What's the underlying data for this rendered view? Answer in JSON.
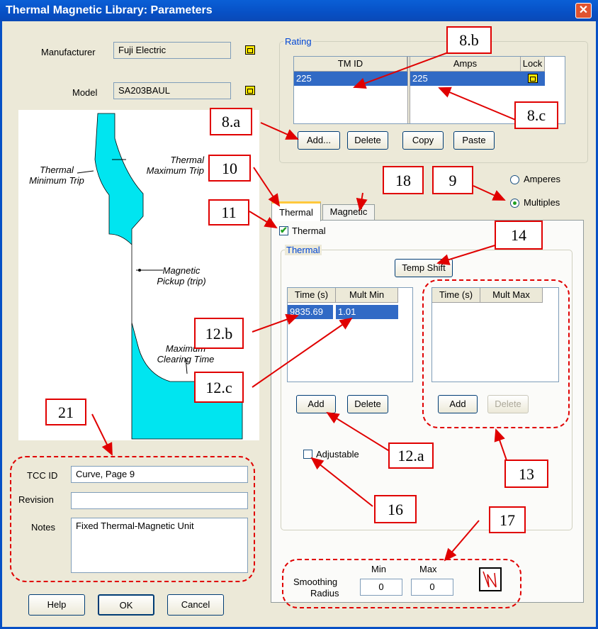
{
  "window": {
    "title": "Thermal Magnetic Library: Parameters",
    "close": "✕"
  },
  "manufacturer": {
    "label": "Manufacturer",
    "value": "Fuji Electric"
  },
  "model": {
    "label": "Model",
    "value": "SA203BAUL"
  },
  "curve_labels": {
    "thermal_min": "Thermal\nMinimum Trip",
    "thermal_max": "Thermal\nMaximum Trip",
    "magnetic": "Magnetic\nPickup (trip)",
    "clearing": "Maximum\nClearing Time"
  },
  "rating": {
    "title": "Rating",
    "columns": [
      "TM ID",
      "Amps",
      "Lock"
    ],
    "rows": [
      {
        "tm_id": "225",
        "amps": "225"
      }
    ],
    "buttons": {
      "add": "Add...",
      "delete": "Delete",
      "copy": "Copy",
      "paste": "Paste"
    }
  },
  "mode": {
    "amperes": "Amperes",
    "multiples": "Multiples",
    "selected": "Multiples"
  },
  "tabs": {
    "thermal": "Thermal",
    "magnetic": "Magnetic",
    "active": "Thermal"
  },
  "thermal_check": {
    "label": "Thermal",
    "checked": true
  },
  "thermal_group": {
    "title": "Thermal",
    "temp_shift": "Temp Shift",
    "min_table": {
      "columns": [
        "Time (s)",
        "Mult Min"
      ],
      "rows": [
        {
          "time": "9835.69",
          "mult": "1.01"
        }
      ]
    },
    "max_table": {
      "columns": [
        "Time (s)",
        "Mult Max"
      ],
      "rows": []
    },
    "add": "Add",
    "delete": "Delete",
    "adjustable": "Adjustable"
  },
  "smoothing": {
    "label_line1": "Smoothing",
    "label_line2": "Radius",
    "min_label": "Min",
    "max_label": "Max",
    "min": "0",
    "max": "0"
  },
  "tcc": {
    "label": "TCC ID",
    "value": "Curve, Page 9"
  },
  "revision": {
    "label": "Revision",
    "value": ""
  },
  "notes": {
    "label": "Notes",
    "value": "Fixed Thermal-Magnetic Unit"
  },
  "footer": {
    "help": "Help",
    "ok": "OK",
    "cancel": "Cancel"
  },
  "callouts": {
    "c8a": "8.a",
    "c8b": "8.b",
    "c8c": "8.c",
    "c9": "9",
    "c10": "10",
    "c11": "11",
    "c12a": "12.a",
    "c12b": "12.b",
    "c12c": "12.c",
    "c13": "13",
    "c14": "14",
    "c16": "16",
    "c17": "17",
    "c18": "18",
    "c21": "21"
  },
  "colors": {
    "selection": "#316ac5",
    "curve": "#00e5f0",
    "callout": "#e00000",
    "group_title": "#0046d5"
  }
}
